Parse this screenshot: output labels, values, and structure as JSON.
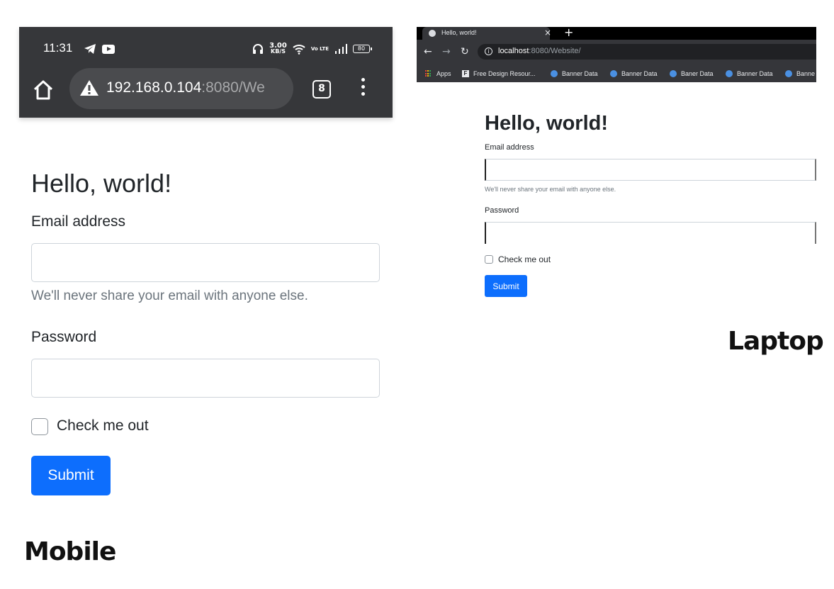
{
  "mobile": {
    "status_bar": {
      "time": "11:31",
      "icons_left": [
        "telegram-icon",
        "youtube-icon"
      ],
      "speed_value": "3.00",
      "speed_unit": "KB/S",
      "volte": "Vo LTE",
      "battery": "80"
    },
    "browser": {
      "url_host": "192.168.0.104",
      "url_rest": ":8080/We",
      "tab_count": "8"
    },
    "form": {
      "heading": "Hello, world!",
      "email_label": "Email address",
      "email_help": "We'll never share your email with anyone else.",
      "password_label": "Password",
      "check_label": "Check me out",
      "submit_label": "Submit"
    },
    "caption": "Mobile"
  },
  "laptop": {
    "browser": {
      "tab_title": "Hello, world!",
      "tab_close": "×",
      "new_tab": "+",
      "url_host": "localhost",
      "url_rest": ":8080/Website/",
      "bookmarks": [
        "Apps",
        "Free Design Resour...",
        "Banner Data",
        "Banner Data",
        "Baner Data",
        "Banner Data",
        "Banne"
      ]
    },
    "form": {
      "heading": "Hello, world!",
      "email_label": "Email address",
      "email_help": "We'll never share your email with anyone else.",
      "password_label": "Password",
      "check_label": "Check me out",
      "submit_label": "Submit"
    },
    "caption": "Laptop"
  },
  "colors": {
    "primary": "#0d6efd",
    "mobile_chrome": "#36373a",
    "laptop_chrome": "#35363a",
    "help_text": "#6c757d"
  }
}
